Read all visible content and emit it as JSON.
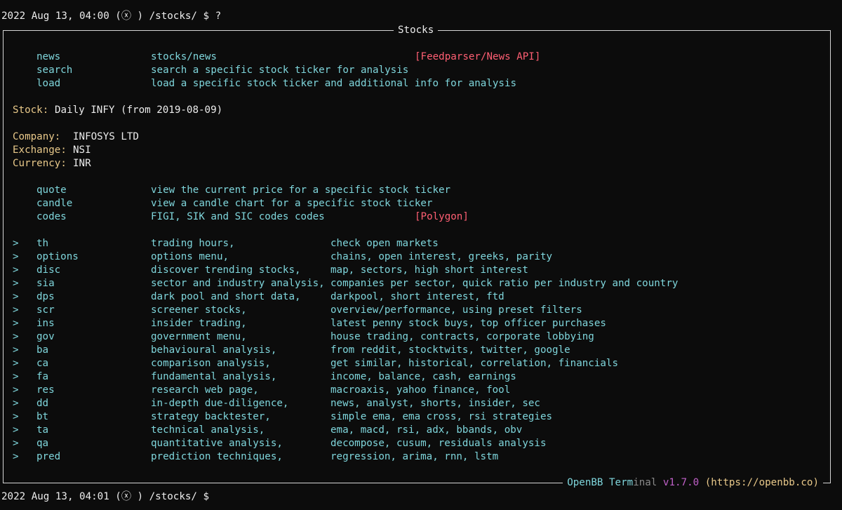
{
  "prompt_top": "2022 Aug 13, 04:00 (ⓧ ) /stocks/ $ ?",
  "prompt_bottom": "2022 Aug 13, 04:01 (ⓧ ) /stocks/ $",
  "panel": {
    "title": "Stocks",
    "footer_openbb": "OpenBB Term",
    "footer_inal": "inal",
    "footer_version": "v1.7.0",
    "footer_url": "(https://openbb.co)"
  },
  "top_commands": [
    {
      "cmd": "news",
      "desc": "stocks/news",
      "src": "[Feedparser/News API]"
    },
    {
      "cmd": "search",
      "desc": "search a specific stock ticker for analysis",
      "src": ""
    },
    {
      "cmd": "load",
      "desc": "load a specific stock ticker and additional info for analysis",
      "src": ""
    }
  ],
  "stock_info": {
    "stock_label": "Stock:",
    "stock_value": "Daily INFY (from 2019-08-09)",
    "company_label": "Company:",
    "company_value": "INFOSYS LTD",
    "exchange_label": "Exchange:",
    "exchange_value": "NSI",
    "currency_label": "Currency:",
    "currency_value": "INR"
  },
  "ticker_commands": [
    {
      "cmd": "quote",
      "desc": "view the current price for a specific stock ticker",
      "src": ""
    },
    {
      "cmd": "candle",
      "desc": "view a candle chart for a specific stock ticker",
      "src": ""
    },
    {
      "cmd": "codes",
      "desc": "FIGI, SIK and SIC codes codes",
      "src": "[Polygon]"
    }
  ],
  "submenus": [
    {
      "arrow": ">",
      "cmd": "th",
      "desc": "trading hours,",
      "extra": "check open markets"
    },
    {
      "arrow": ">",
      "cmd": "options",
      "desc": "options menu,",
      "extra": "chains, open interest, greeks, parity"
    },
    {
      "arrow": ">",
      "cmd": "disc",
      "desc": "discover trending stocks,",
      "extra": "map, sectors, high short interest"
    },
    {
      "arrow": ">",
      "cmd": "sia",
      "desc": "sector and industry analysis,",
      "extra": "companies per sector, quick ratio per industry and country"
    },
    {
      "arrow": ">",
      "cmd": "dps",
      "desc": "dark pool and short data,",
      "extra": "darkpool, short interest, ftd"
    },
    {
      "arrow": ">",
      "cmd": "scr",
      "desc": "screener stocks,",
      "extra": "overview/performance, using preset filters"
    },
    {
      "arrow": ">",
      "cmd": "ins",
      "desc": "insider trading,",
      "extra": "latest penny stock buys, top officer purchases"
    },
    {
      "arrow": ">",
      "cmd": "gov",
      "desc": "government menu,",
      "extra": "house trading, contracts, corporate lobbying"
    },
    {
      "arrow": ">",
      "cmd": "ba",
      "desc": "behavioural analysis,",
      "extra": "from reddit, stocktwits, twitter, google"
    },
    {
      "arrow": ">",
      "cmd": "ca",
      "desc": "comparison analysis,",
      "extra": "get similar, historical, correlation, financials"
    },
    {
      "arrow": ">",
      "cmd": "fa",
      "desc": "fundamental analysis,",
      "extra": "income, balance, cash, earnings"
    },
    {
      "arrow": ">",
      "cmd": "res",
      "desc": "research web page,",
      "extra": "macroaxis, yahoo finance, fool"
    },
    {
      "arrow": ">",
      "cmd": "dd",
      "desc": "in-depth due-diligence,",
      "extra": "news, analyst, shorts, insider, sec"
    },
    {
      "arrow": ">",
      "cmd": "bt",
      "desc": "strategy backtester,",
      "extra": "simple ema, ema cross, rsi strategies"
    },
    {
      "arrow": ">",
      "cmd": "ta",
      "desc": "technical analysis,",
      "extra": "ema, macd, rsi, adx, bbands, obv"
    },
    {
      "arrow": ">",
      "cmd": "qa",
      "desc": "quantitative analysis,",
      "extra": "decompose, cusum, residuals analysis"
    },
    {
      "arrow": ">",
      "cmd": "pred",
      "desc": "prediction techniques,",
      "extra": "regression, arima, rnn, lstm"
    }
  ],
  "colors": {
    "command": "#7fd6dc",
    "label": "#e9c98a",
    "source": "#ff5f73",
    "background": "#0c0c0c"
  }
}
